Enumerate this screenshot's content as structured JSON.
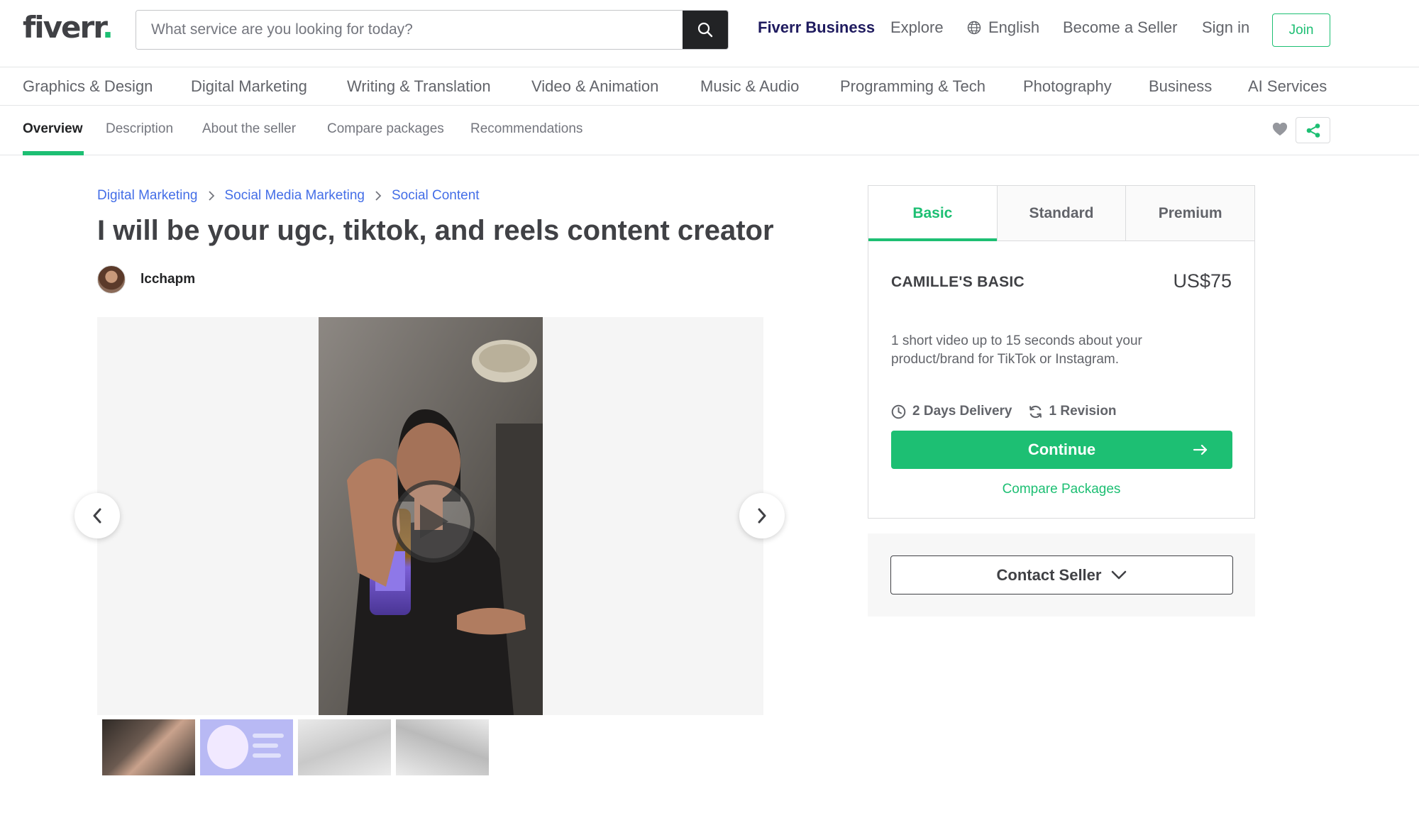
{
  "header": {
    "logo_text": "fiverr",
    "logo_dot": ".",
    "search_placeholder": "What service are you looking for today?",
    "nav": {
      "fiverr_business": "Fiverr Business",
      "explore": "Explore",
      "language": "English",
      "become_seller": "Become a Seller",
      "sign_in": "Sign in",
      "join": "Join"
    }
  },
  "categories": [
    "Graphics & Design",
    "Digital Marketing",
    "Writing & Translation",
    "Video & Animation",
    "Music & Audio",
    "Programming & Tech",
    "Photography",
    "Business",
    "AI Services"
  ],
  "tabs": [
    "Overview",
    "Description",
    "About the seller",
    "Compare packages",
    "Recommendations"
  ],
  "breadcrumb": [
    "Digital Marketing",
    "Social Media Marketing",
    "Social Content"
  ],
  "gig": {
    "title": "I will be your ugc, tiktok, and reels content creator",
    "seller_name": "lcchapm"
  },
  "package": {
    "tabs": [
      "Basic",
      "Standard",
      "Premium"
    ],
    "active_tab": "Basic",
    "name": "CAMILLE'S BASIC",
    "price": "US$75",
    "description": "1 short video up to 15 seconds about your product/brand for TikTok or Instagram.",
    "delivery": "2 Days Delivery",
    "revisions": "1 Revision",
    "continue_label": "Continue",
    "compare_label": "Compare Packages"
  },
  "contact": {
    "label": "Contact Seller"
  },
  "colors": {
    "brand_green": "#1dbf73",
    "business_navy": "#1f1b5f",
    "link_blue": "#446ee7",
    "text_dark": "#404145"
  },
  "icons": [
    "search-icon",
    "globe-icon",
    "heart-icon",
    "share-icon",
    "chevron-right-icon",
    "play-icon",
    "clock-icon",
    "refresh-icon",
    "arrow-right-icon",
    "chevron-down-icon"
  ]
}
